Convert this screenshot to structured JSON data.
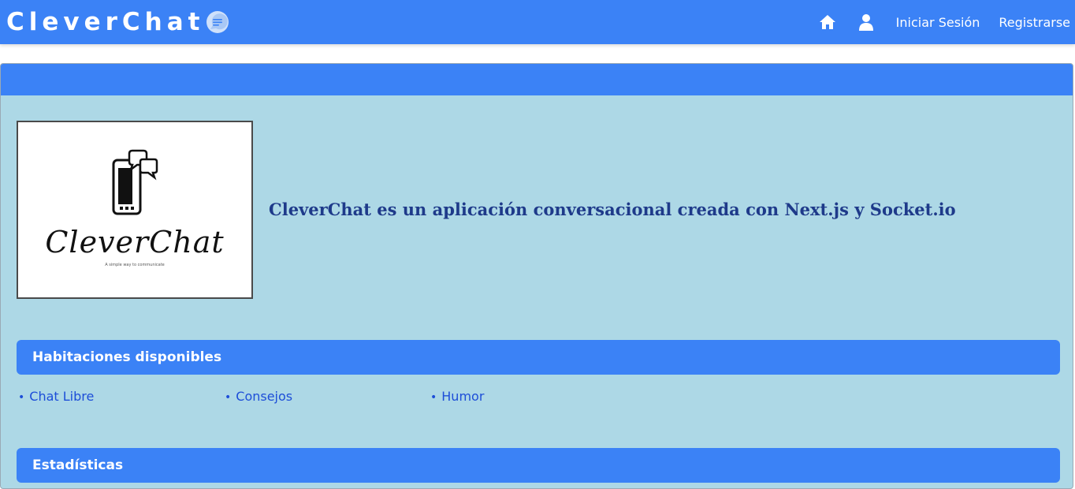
{
  "navbar": {
    "brand": "CleverChat",
    "links": {
      "login": "Iniciar Sesión",
      "register": "Registrarse"
    },
    "icons": [
      "chat-bubble-icon",
      "home-icon",
      "user-icon"
    ]
  },
  "intro": {
    "logo": {
      "text": "CleverChat",
      "tagline": "A simple way to communicate"
    },
    "description": "CleverChat es un aplicación conversacional creada con Next.js y Socket.io"
  },
  "rooms": {
    "title": "Habitaciones disponibles",
    "items": [
      {
        "label": "Chat Libre"
      },
      {
        "label": "Consejos"
      },
      {
        "label": "Humor"
      }
    ]
  },
  "stats": {
    "title": "Estadísticas"
  },
  "colors": {
    "primary": "#3b82f6",
    "panel_background": "#add8e6",
    "link": "#1d4ed8",
    "description_text": "#1e3a8a"
  }
}
